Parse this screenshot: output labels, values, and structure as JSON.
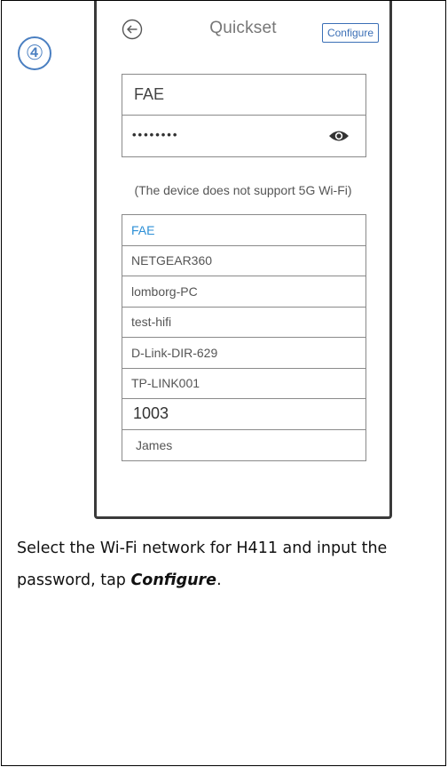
{
  "step": {
    "number": "④"
  },
  "header": {
    "back_icon": "back-arrow-circle-icon",
    "title": "Quickset",
    "configure_label": "Configure"
  },
  "wifi": {
    "ssid_value": "FAE",
    "password_masked": "••••••••",
    "show_password_icon": "eye-icon",
    "note": "(The device does not support 5G Wi-Fi)"
  },
  "networks": [
    {
      "name": "FAE",
      "selected": true
    },
    {
      "name": "NETGEAR360",
      "selected": false
    },
    {
      "name": "lomborg-PC",
      "selected": false
    },
    {
      "name": "test-hifi",
      "selected": false
    },
    {
      "name": "D-Link-DIR-629",
      "selected": false
    },
    {
      "name": "TP-LINK001",
      "selected": false
    },
    {
      "name": "1003",
      "selected": false
    },
    {
      "name": "James",
      "selected": false
    }
  ],
  "caption": {
    "text_before": "Select the Wi-Fi network for H411 and input the password, tap ",
    "emphasis": "Configure",
    "text_after": "."
  },
  "colors": {
    "accent": "#3b6fb6",
    "selected_network": "#2c8fd6",
    "step_badge": "#4a7fc1"
  }
}
